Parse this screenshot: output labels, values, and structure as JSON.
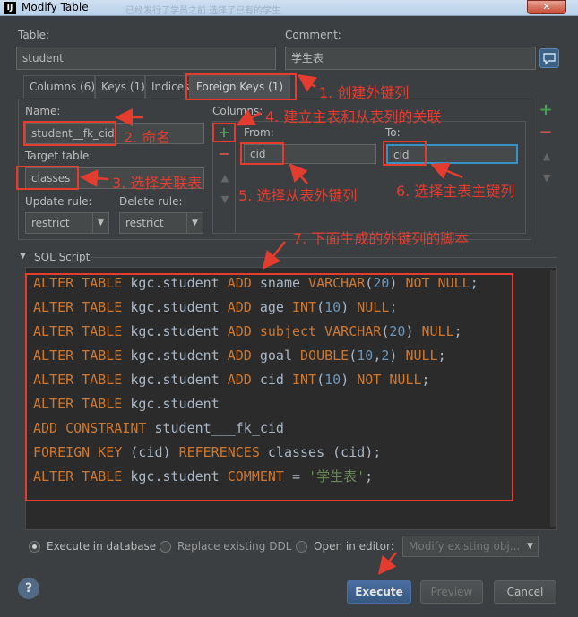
{
  "window": {
    "title": "Modify Table",
    "ghost_text": "已经发行了学员之前 选择了已有的学生"
  },
  "table": {
    "label": "Table:",
    "value": "student"
  },
  "comment": {
    "label": "Comment:",
    "value": "学生表"
  },
  "tabs": [
    {
      "label": "Columns (6)"
    },
    {
      "label": "Keys (1)"
    },
    {
      "label": "Indices"
    },
    {
      "label": "Foreign Keys (1)"
    }
  ],
  "fk": {
    "name_label": "Name:",
    "name_value": "student__fk_cid",
    "target_label": "Target table:",
    "target_value": "classes",
    "update_label": "Update rule:",
    "update_value": "restrict",
    "delete_label": "Delete rule:",
    "delete_value": "restrict",
    "columns_label": "Columns:",
    "from_label": "From:",
    "from_value": "cid",
    "to_label": "To:",
    "to_value": "cid"
  },
  "annotations": {
    "a1": "1. 创建外键列",
    "a2": "2. 命名",
    "a3": "3. 选择关联表",
    "a4": "4. 建立主表和从表列的关联",
    "a5": "5. 选择从表外键列",
    "a6": "6. 选择主表主键列",
    "a7": "7. 下面生成的外键列的脚本"
  },
  "sql": {
    "label": "SQL Script",
    "lines": [
      "ALTER TABLE kgc.student ADD sname VARCHAR(20) NOT NULL;",
      "ALTER TABLE kgc.student ADD age INT(10) NULL;",
      "ALTER TABLE kgc.student ADD subject VARCHAR(20) NULL;",
      "ALTER TABLE kgc.student ADD goal DOUBLE(10,2) NULL;",
      "ALTER TABLE kgc.student ADD cid INT(10) NOT NULL;",
      "ALTER TABLE kgc.student",
      "ADD CONSTRAINT student___fk_cid",
      "FOREIGN KEY (cid) REFERENCES classes (cid);",
      "ALTER TABLE kgc.student COMMENT = '学生表';"
    ]
  },
  "options": {
    "execute": "Execute in database",
    "replace": "Replace existing DDL",
    "open": "Open in editor:",
    "open_select": "Modify existing obj..."
  },
  "buttons": {
    "help": "?",
    "execute": "Execute",
    "preview": "Preview",
    "cancel": "Cancel"
  },
  "colors": {
    "annotation": "#e53c30",
    "keyword": "#cc7832",
    "number": "#6897bb",
    "string": "#6a8759",
    "add": "#499c54",
    "remove": "#c75450"
  }
}
